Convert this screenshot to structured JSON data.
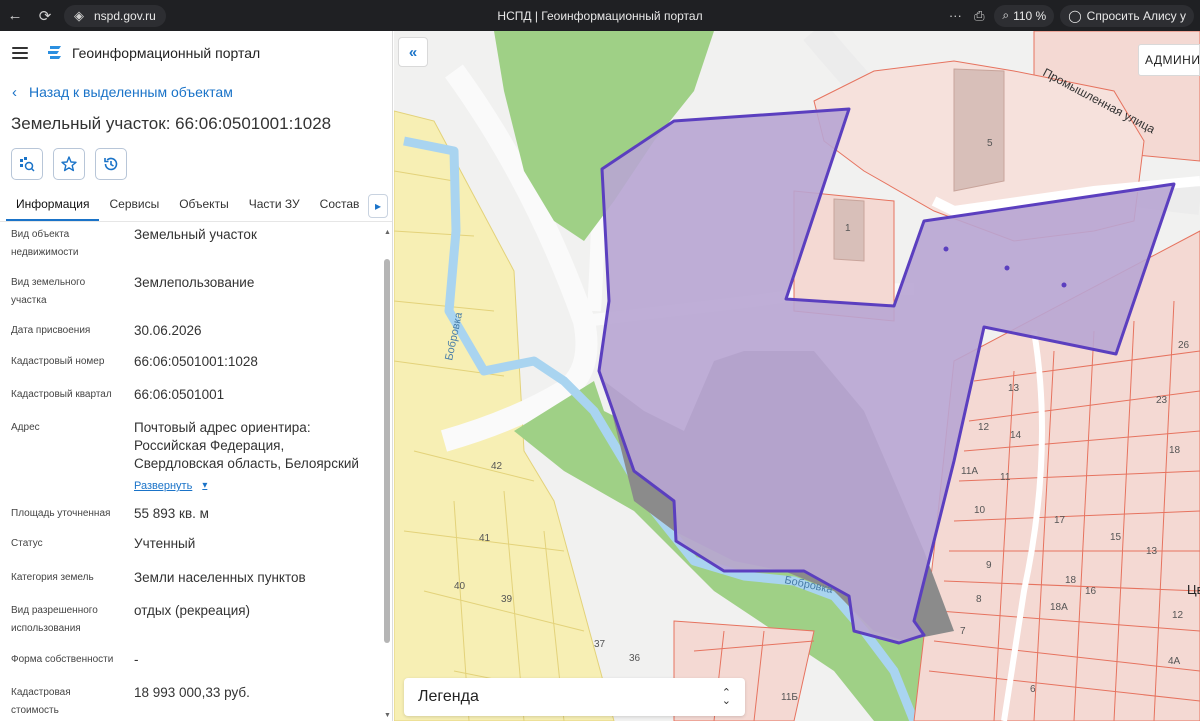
{
  "browser": {
    "url": "nspd.gov.ru",
    "tab_title": "НСПД | Геоинформационный портал",
    "zoom": "110 %",
    "ask": "Спросить Алису у"
  },
  "panel": {
    "portal_title": "Геоинформационный портал",
    "back_label": "Назад к выделенным объектам",
    "object_title": "Земельный участок: 66:06:0501001:1028",
    "tabs": [
      "Информация",
      "Сервисы",
      "Объекты",
      "Части ЗУ",
      "Состав"
    ],
    "active_tab": "Информация",
    "properties": [
      {
        "label": "Вид объекта недвижимости",
        "value": "Земельный участок"
      },
      {
        "label": "Вид земельного участка",
        "value": "Землепользование"
      },
      {
        "label": "Дата присвоения",
        "value": "30.06.2026"
      },
      {
        "label": "Кадастровый номер",
        "value": "66:06:0501001:1028"
      },
      {
        "label": "Кадастровый квартал",
        "value": "66:06:0501001"
      },
      {
        "label": "Адрес",
        "value": "Почтовый адрес ориентира: Российская Федерация, Свердловская область, Белоярский"
      },
      {
        "label": "Площадь уточненная",
        "value": "55 893 кв. м"
      },
      {
        "label": "Статус",
        "value": "Учтенный"
      },
      {
        "label": "Категория земель",
        "value": "Земли населенных пунктов"
      },
      {
        "label": "Вид разрешенного использования",
        "value": "отдых (рекреация)"
      },
      {
        "label": "Форма собственности",
        "value": "-"
      },
      {
        "label": "Кадастровая стоимость",
        "value": "18 993 000,33 руб."
      }
    ],
    "expand_label": "Развернуть"
  },
  "map": {
    "admin_label": "АДМИНИ",
    "legend_title": "Легенда",
    "street_label": "Промышленная улица",
    "river_labels": [
      "Бобровка",
      "Бобровка"
    ],
    "cut_label": "Цв",
    "parcel_numbers": [
      "5",
      "1",
      "26",
      "23",
      "18",
      "13",
      "12",
      "14",
      "11А",
      "11",
      "10",
      "9",
      "8",
      "7",
      "17",
      "15",
      "13",
      "18",
      "16",
      "18А",
      "12",
      "6",
      "4А",
      "11Б",
      "42",
      "41",
      "40",
      "39",
      "37",
      "36"
    ],
    "colors": {
      "selected_fill": "#b8a5d3",
      "selected_stroke": "#5b3fbf",
      "forest": "#9fd086",
      "river": "#a9d4f0",
      "residential": "#f4d9d3",
      "parcel_line": "#e6735f",
      "yellow_zone": "#f7efb4",
      "gray_zone": "#8b8b8b"
    }
  }
}
